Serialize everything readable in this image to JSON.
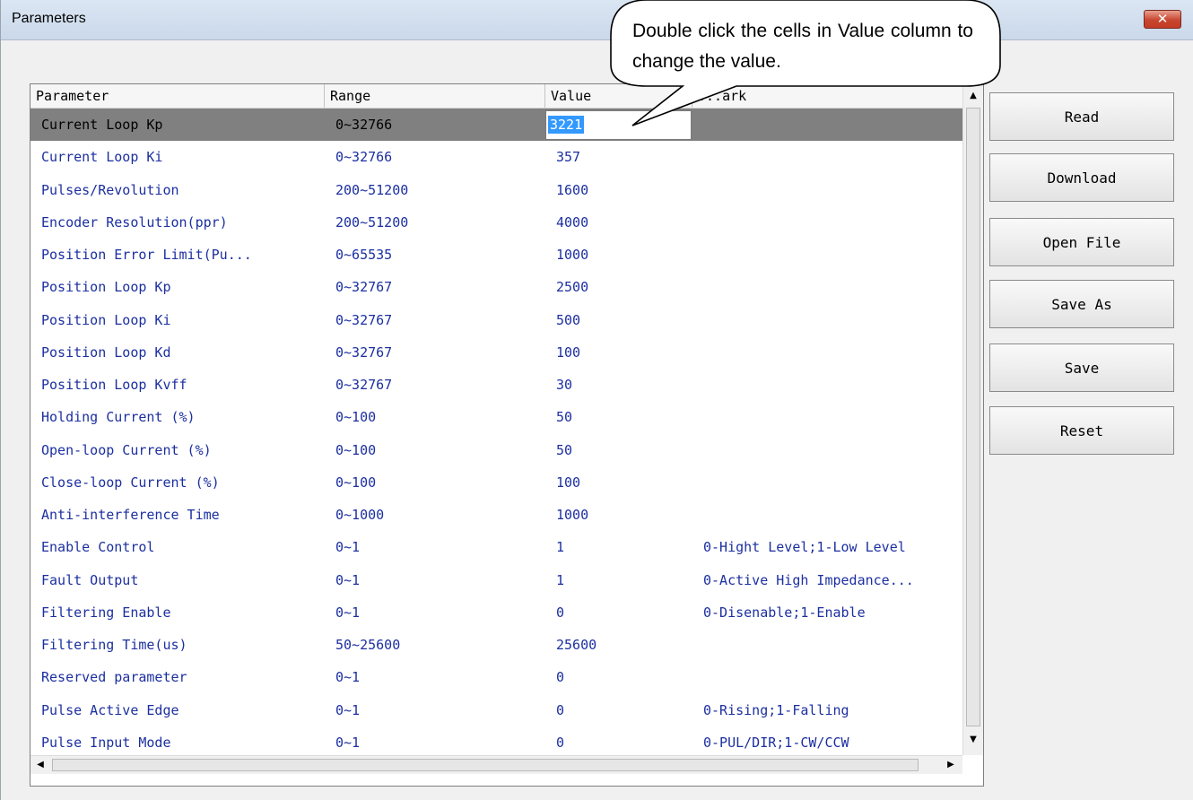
{
  "window": {
    "title": "Parameters",
    "close_glyph": "✕"
  },
  "grid": {
    "columns": [
      "Parameter",
      "Range",
      "Value",
      "Remark"
    ],
    "columns_header_display": [
      "Parameter",
      "Range",
      "Value",
      "...ark"
    ],
    "editing_value": "3221",
    "rows": [
      {
        "param": "Current Loop Kp",
        "range": "0~32766",
        "value": "3221",
        "remark": ""
      },
      {
        "param": "Current Loop Ki",
        "range": "0~32766",
        "value": "357",
        "remark": ""
      },
      {
        "param": "Pulses/Revolution",
        "range": "200~51200",
        "value": "1600",
        "remark": ""
      },
      {
        "param": "Encoder Resolution(ppr)",
        "range": "200~51200",
        "value": "4000",
        "remark": ""
      },
      {
        "param": "Position Error Limit(Pu...",
        "range": "0~65535",
        "value": "1000",
        "remark": ""
      },
      {
        "param": "Position Loop Kp",
        "range": "0~32767",
        "value": "2500",
        "remark": ""
      },
      {
        "param": "Position Loop Ki",
        "range": "0~32767",
        "value": "500",
        "remark": ""
      },
      {
        "param": "Position Loop Kd",
        "range": "0~32767",
        "value": "100",
        "remark": ""
      },
      {
        "param": "Position Loop Kvff",
        "range": "0~32767",
        "value": "30",
        "remark": ""
      },
      {
        "param": "Holding Current (%)",
        "range": "0~100",
        "value": "50",
        "remark": ""
      },
      {
        "param": "Open-loop Current (%)",
        "range": "0~100",
        "value": "50",
        "remark": ""
      },
      {
        "param": "Close-loop Current (%)",
        "range": "0~100",
        "value": "100",
        "remark": ""
      },
      {
        "param": "Anti-interference Time",
        "range": "0~1000",
        "value": "1000",
        "remark": ""
      },
      {
        "param": "Enable Control",
        "range": "0~1",
        "value": "1",
        "remark": "0-Hight Level;1-Low Level"
      },
      {
        "param": "Fault Output",
        "range": "0~1",
        "value": "1",
        "remark": "0-Active High Impedance..."
      },
      {
        "param": "Filtering Enable",
        "range": "0~1",
        "value": "0",
        "remark": "0-Disenable;1-Enable"
      },
      {
        "param": "Filtering Time(us)",
        "range": "50~25600",
        "value": "25600",
        "remark": ""
      },
      {
        "param": "Reserved parameter",
        "range": "0~1",
        "value": "0",
        "remark": ""
      },
      {
        "param": "Pulse Active Edge",
        "range": "0~1",
        "value": "0",
        "remark": "0-Rising;1-Falling"
      },
      {
        "param": "Pulse Input Mode",
        "range": "0~1",
        "value": "0",
        "remark": "0-PUL/DIR;1-CW/CCW"
      }
    ],
    "scroll_glyphs": {
      "up": "▲",
      "down": "▼",
      "left": "◀",
      "right": "▶"
    }
  },
  "buttons": {
    "read": "Read",
    "download": "Download",
    "open_file": "Open File",
    "save_as": "Save As",
    "save": "Save",
    "reset": "Reset"
  },
  "callout": {
    "text": "Double click the cells in Value column to change the value."
  },
  "colors": {
    "selected_row": "#808080",
    "cell_text": "#1c2fa0",
    "highlight": "#3399ff"
  }
}
